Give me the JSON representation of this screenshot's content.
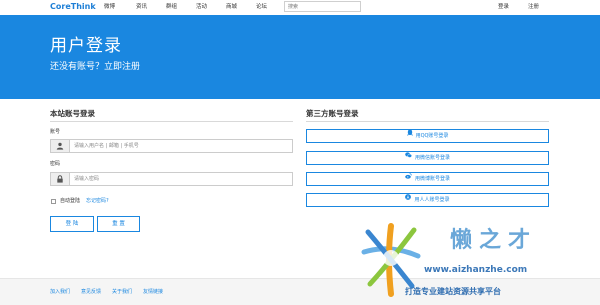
{
  "navbar": {
    "brand": "CoreThink",
    "items": [
      "微博",
      "资讯",
      "群组",
      "活动",
      "商城",
      "论坛"
    ],
    "search_placeholder": "搜索",
    "login": "登录",
    "register": "注册"
  },
  "hero": {
    "title": "用户登录",
    "subtitle": "还没有账号？立即注册"
  },
  "local_login": {
    "title": "本站账号登录",
    "account_label": "账号",
    "account_placeholder": "请输入用户名 | 邮箱 | 手机号",
    "password_label": "密码",
    "password_placeholder": "请输入密码",
    "remember_label": "自动登陆",
    "forgot_link": "忘记密码?",
    "login_button": "登 陆",
    "reset_button": "重 置"
  },
  "third_party": {
    "title": "第三方账号登录",
    "buttons": [
      {
        "label": "用QQ账号登录",
        "icon": "qq-icon"
      },
      {
        "label": "用微信账号登录",
        "icon": "wechat-icon"
      },
      {
        "label": "用微博账号登录",
        "icon": "weibo-icon"
      },
      {
        "label": "用人人账号登录",
        "icon": "renren-icon"
      }
    ]
  },
  "footer": {
    "links": [
      "加入我们",
      "意见反馈",
      "关于我们",
      "友情链接"
    ]
  },
  "watermark": {
    "brand": "懒之才",
    "url": "www.aizhanzhe.com",
    "tagline": "打造专业建站资源共享平台"
  },
  "colors": {
    "accent": "#1a87e0",
    "brand_text": "#1e7fd6",
    "footer_bg": "#f5f5f5"
  }
}
